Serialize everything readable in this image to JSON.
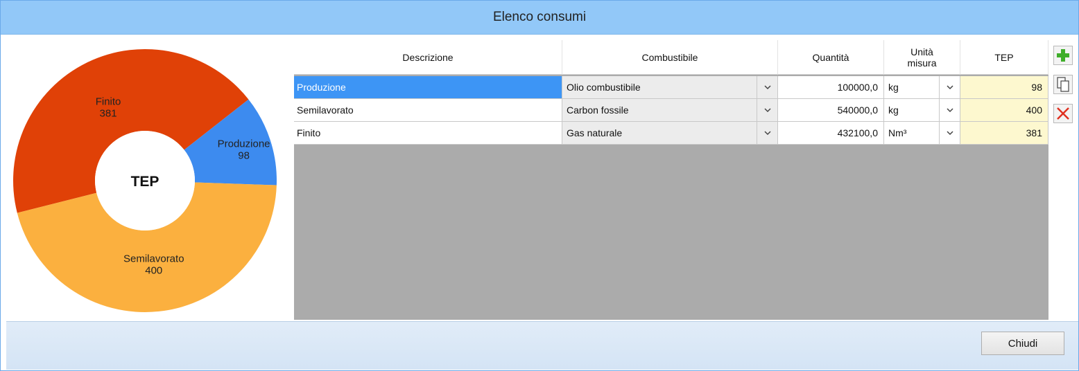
{
  "window": {
    "title": "Elenco consumi"
  },
  "chart_data": {
    "type": "pie",
    "center_label": "TEP",
    "slices": [
      {
        "label": "Finito",
        "value": 381,
        "color": "#e04107"
      },
      {
        "label": "Produzione",
        "value": 98,
        "color": "#3d8bef"
      },
      {
        "label": "Semilavorato",
        "value": 400,
        "color": "#fbb03f"
      }
    ]
  },
  "table": {
    "headers": {
      "descrizione": "Descrizione",
      "combustibile": "Combustibile",
      "quantita": "Quantità",
      "unita": "Unità misura",
      "tep": "TEP"
    },
    "rows": [
      {
        "descrizione": "Produzione",
        "combustibile": "Olio combustibile",
        "quantita": "100000,0",
        "unita": "kg",
        "tep": "98"
      },
      {
        "descrizione": "Semilavorato",
        "combustibile": "Carbon fossile",
        "quantita": "540000,0",
        "unita": "kg",
        "tep": "400"
      },
      {
        "descrizione": "Finito",
        "combustibile": "Gas naturale",
        "quantita": "432100,0",
        "unita": "Nm³",
        "tep": "381"
      }
    ]
  },
  "toolbar": {
    "add_icon": "plus-icon",
    "copy_icon": "copy-icon",
    "delete_icon": "delete-x-icon"
  },
  "footer": {
    "close_label": "Chiudi"
  }
}
